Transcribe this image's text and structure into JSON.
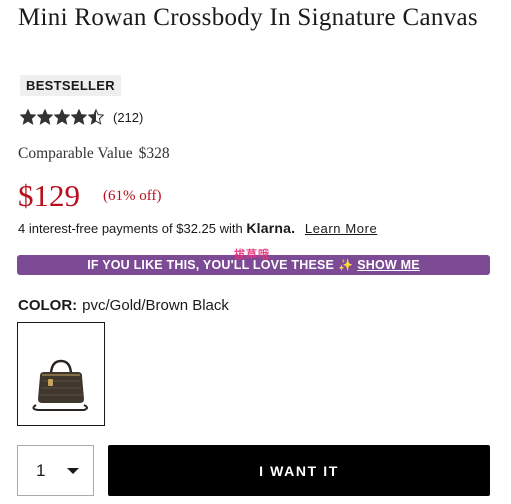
{
  "product": {
    "title": "Mini Rowan Crossbody In Signature Canvas",
    "badge": "BESTSELLER",
    "rating": {
      "value": 4.5,
      "max": 5,
      "count_text": "(212)"
    },
    "comparable": {
      "label": "Comparable Value",
      "amount": "$328"
    },
    "price": "$129",
    "discount": "(61% off)"
  },
  "klarna": {
    "text": "4 interest-free payments of $32.25 with",
    "brand": "Klarna.",
    "link": "Learn More"
  },
  "promo": {
    "text": "IF YOU LIKE THIS, YOU'LL LOVE THESE",
    "icon": "sparkle-icon",
    "link": "SHOW ME",
    "color": "#7d4a96"
  },
  "watermark": "拔草哦",
  "color_selector": {
    "label": "COLOR:",
    "value": "pvc/Gold/Brown Black"
  },
  "quantity": {
    "value": "1"
  },
  "cta": {
    "label": "I WANT IT"
  },
  "colors": {
    "price": "#b80f1d",
    "cta_bg": "#000000"
  }
}
